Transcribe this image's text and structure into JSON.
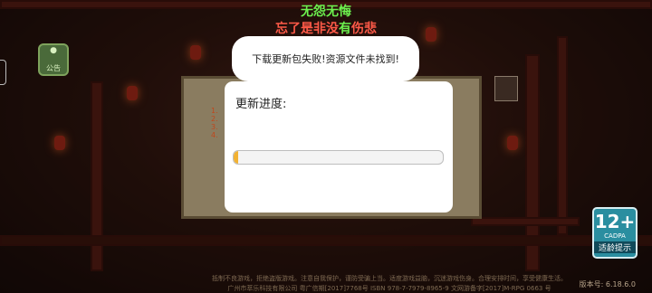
{
  "header": {
    "line1": "无怨无悔",
    "line2_part_red1": "忘了是非没",
    "line2_part_green": "有",
    "line2_part_red2": "伤悲"
  },
  "announcement_button": {
    "label": "公告"
  },
  "background_panel": {
    "lines": [
      "1.",
      "2.",
      "3.",
      "4."
    ]
  },
  "toast": {
    "message": "下载更新包失败!资源文件未找到!"
  },
  "update_dialog": {
    "title": "更新进度:",
    "progress_fraction": 0.02
  },
  "age_rating": {
    "number": "12+",
    "org": "CADPA",
    "label": "适龄提示"
  },
  "footer": {
    "line1": "抵制不良游戏，拒绝盗版游戏。注意自我保护，谨防受骗上当。适度游戏益脑，沉迷游戏伤身。合理安排时间，享受健康生活。",
    "line2": "广州市萃乐科技有限公司 粤广信期[2017]7768号 ISBN 978-7-7979-8965-9 文网游备字[2017]M-RPG 0663 号"
  },
  "version": "版本号: 6.18.6.0",
  "colors": {
    "title_green": "#6cf04e",
    "title_red": "#ff5a48",
    "progress_fill": "#f2b233",
    "age_badge": "#2a8ea0"
  }
}
